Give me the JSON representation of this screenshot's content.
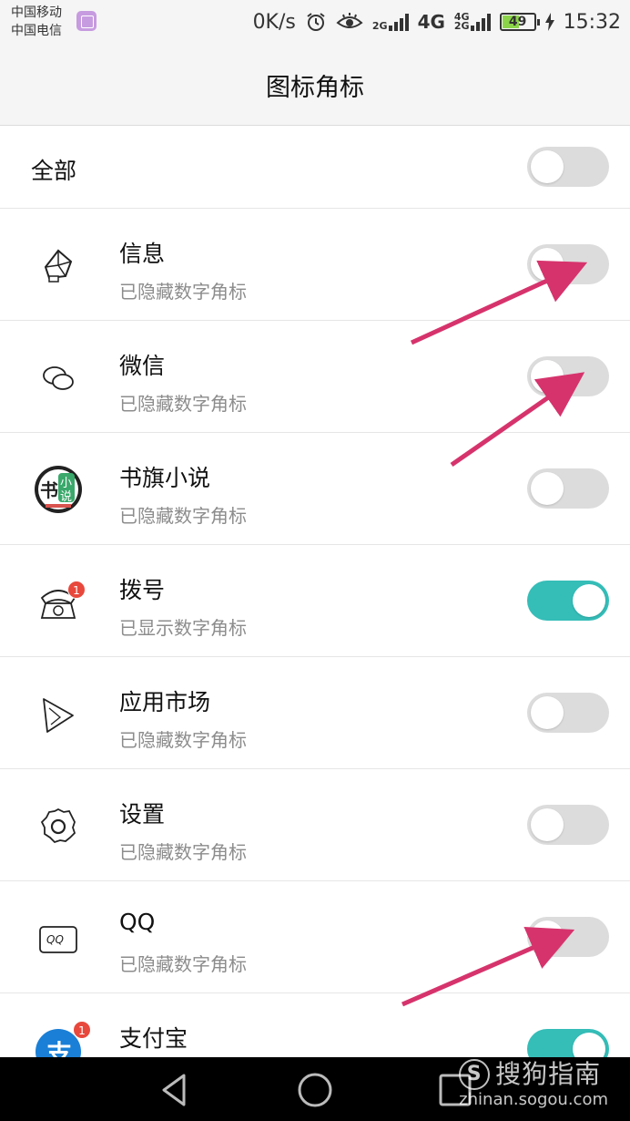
{
  "status_bar": {
    "carrier_1": "中国移动",
    "carrier_2": "中国电信",
    "net_speed": "0K/s",
    "network_1": "4G",
    "battery_level": "49",
    "time": "15:32"
  },
  "header": {
    "title": "图标角标"
  },
  "all_row": {
    "label": "全部",
    "toggle_on": false
  },
  "apps": [
    {
      "name": "信息",
      "status": "已隐藏数字角标",
      "icon": "message-icon",
      "toggle_on": false
    },
    {
      "name": "微信",
      "status": "已隐藏数字角标",
      "icon": "wechat-icon",
      "toggle_on": false
    },
    {
      "name": "书旗小说",
      "status": "已隐藏数字角标",
      "icon": "shuqi-novel-icon",
      "toggle_on": false
    },
    {
      "name": "拨号",
      "status": "已显示数字角标",
      "icon": "phone-dialer-icon",
      "badge": "1",
      "toggle_on": true
    },
    {
      "name": "应用市场",
      "status": "已隐藏数字角标",
      "icon": "app-market-icon",
      "toggle_on": false
    },
    {
      "name": "设置",
      "status": "已隐藏数字角标",
      "icon": "settings-gear-icon",
      "toggle_on": false
    },
    {
      "name": "QQ",
      "status": "已隐藏数字角标",
      "icon": "qq-icon",
      "icon_text": "QQ",
      "toggle_on": false
    },
    {
      "name": "支付宝",
      "status": "",
      "icon": "alipay-icon",
      "icon_text": "支",
      "badge": "1",
      "toggle_on": true
    }
  ],
  "shuqi_icon_text": {
    "a": "书",
    "b": "小",
    "c": "说"
  },
  "watermark": {
    "brand": "搜狗指南",
    "url": "zhinan.sogou.com",
    "logo_letter": "S"
  },
  "colors": {
    "toggle_on": "#35bdb8",
    "toggle_off": "#dcdcdc",
    "arrow": "#d6336c",
    "badge": "#e8483c"
  }
}
